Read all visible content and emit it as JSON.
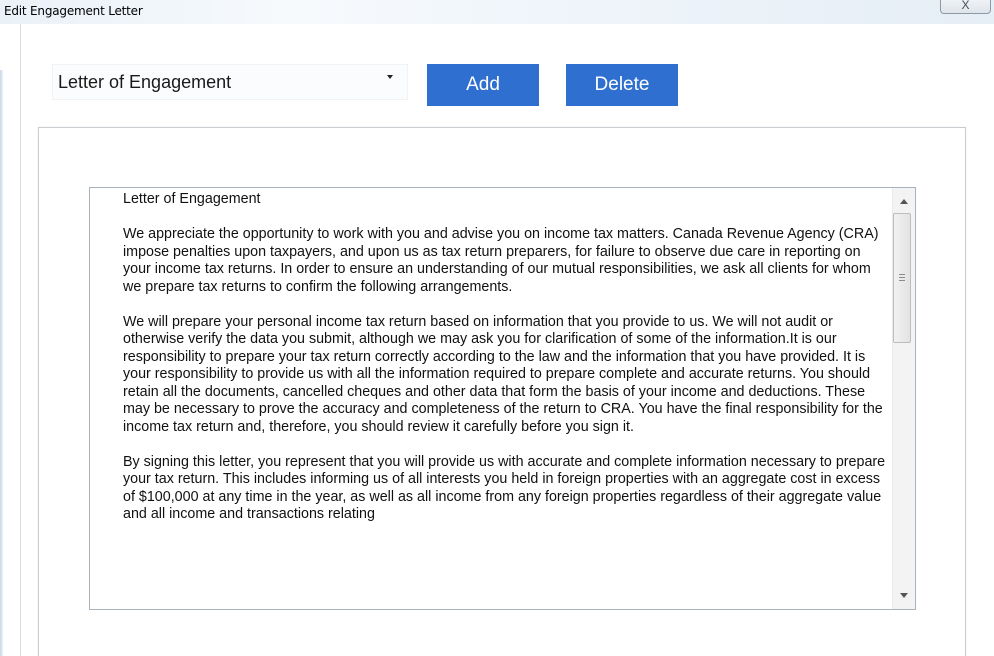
{
  "window": {
    "title": "Edit Engagement Letter",
    "close_glyph": "X"
  },
  "toolbar": {
    "template_select": {
      "value": "Letter of Engagement"
    },
    "add_label": "Add",
    "delete_label": "Delete",
    "button_color": "#2f6fd0"
  },
  "editor": {
    "heading": "Letter of Engagement",
    "paragraphs": [
      "We appreciate the opportunity to work with you and advise you on income tax matters. Canada Revenue Agency (CRA) impose penalties upon taxpayers, and upon us as tax return preparers, for failure to observe due care in reporting on your income tax returns. In order to ensure an understanding of our mutual responsibilities, we ask all clients for whom we prepare tax returns to confirm the following arrangements.",
      "We will prepare your personal income tax return based on information that you provide to us. We will not audit or otherwise verify the data you submit, although we may ask you for clarification of some of the information.It is our responsibility to prepare your tax return correctly according to the law and the information that you have provided. It is your responsibility to provide us with all the information required to prepare complete and accurate returns. You should retain all the documents, cancelled cheques and other data that form the basis of your income and deductions. These may be necessary to prove the accuracy and completeness of the return to CRA. You have the final responsibility for the income tax return and, therefore, you should review it carefully before you sign it.",
      "By signing this letter, you represent that you will provide us with accurate and complete information necessary to prepare your tax return. This includes informing us of all interests you held in foreign properties with an aggregate cost in excess of $100,000 at any time in the year, as well as all income from any foreign properties regardless of their aggregate value and all income and transactions relating"
    ]
  }
}
